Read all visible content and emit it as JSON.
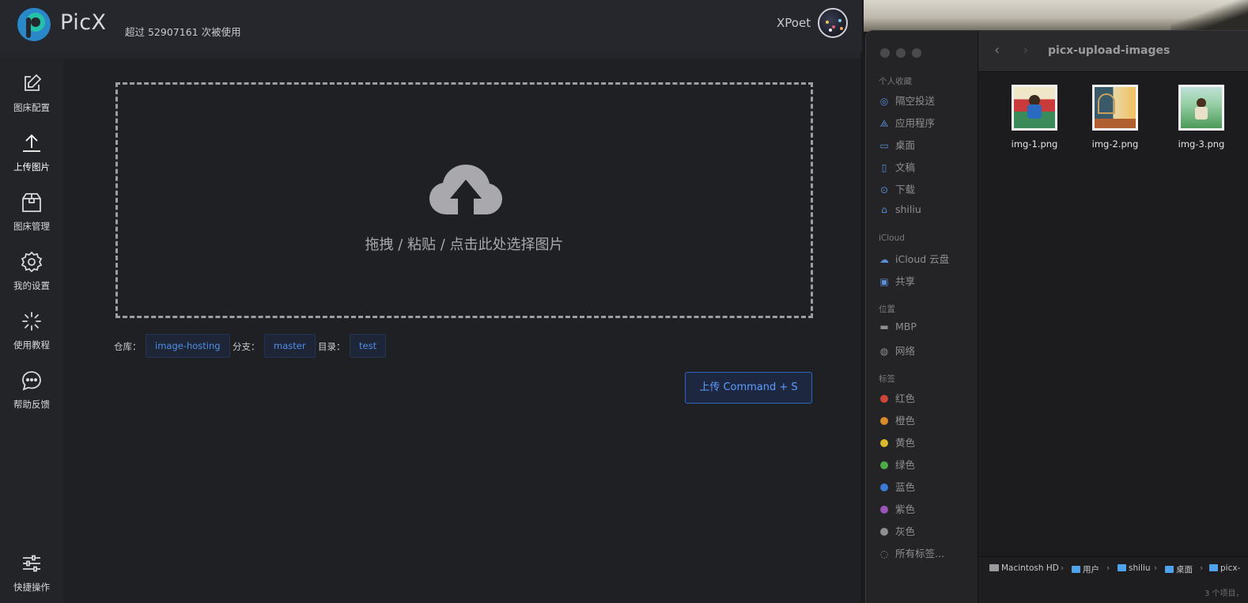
{
  "app": {
    "name": "PicX",
    "usage_text": "超过 52907161 次被使用",
    "username": "XPoet"
  },
  "sidebar": {
    "items": [
      {
        "label": "图床配置",
        "icon": "edit-icon",
        "active": false
      },
      {
        "label": "上传图片",
        "icon": "upload-icon",
        "active": true
      },
      {
        "label": "图床管理",
        "icon": "package-icon",
        "active": false
      },
      {
        "label": "我的设置",
        "icon": "gear-icon",
        "active": false
      },
      {
        "label": "使用教程",
        "icon": "loading-icon",
        "active": false
      },
      {
        "label": "帮助反馈",
        "icon": "chat-icon",
        "active": false
      }
    ],
    "bottom_item": {
      "label": "快捷操作",
      "icon": "sliders-icon"
    }
  },
  "upload": {
    "drop_text": "拖拽 / 粘贴 / 点击此处选择图片",
    "repo_label": "仓库：",
    "repo_value": "image-hosting",
    "branch_label": "分支：",
    "branch_value": "master",
    "dir_label": "目录：",
    "dir_value": "test",
    "upload_button": "上传 Command + S"
  },
  "finder": {
    "title": "picx-upload-images",
    "sections": {
      "favorites": "个人收藏",
      "icloud": "iCloud",
      "locations": "位置",
      "tags": "标签"
    },
    "favorites": [
      "隔空投送",
      "应用程序",
      "桌面",
      "文稿",
      "下载",
      "shiliu"
    ],
    "icloud_items": [
      "iCloud 云盘",
      "共享"
    ],
    "locations": [
      "MBP",
      "网络"
    ],
    "tags": [
      {
        "label": "红色",
        "color": "#d0453a"
      },
      {
        "label": "橙色",
        "color": "#d98a2b"
      },
      {
        "label": "黄色",
        "color": "#d9b82b"
      },
      {
        "label": "绿色",
        "color": "#4caa48"
      },
      {
        "label": "蓝色",
        "color": "#3a7bd5"
      },
      {
        "label": "紫色",
        "color": "#9a55b8"
      },
      {
        "label": "灰色",
        "color": "#8e8e92"
      }
    ],
    "all_tags": "所有标签...",
    "files": [
      "img-1.png",
      "img-2.png",
      "img-3.png"
    ],
    "path": [
      "Macintosh HD",
      "用户",
      "shiliu",
      "桌面",
      "picx-"
    ],
    "status": "3 个项目，"
  }
}
